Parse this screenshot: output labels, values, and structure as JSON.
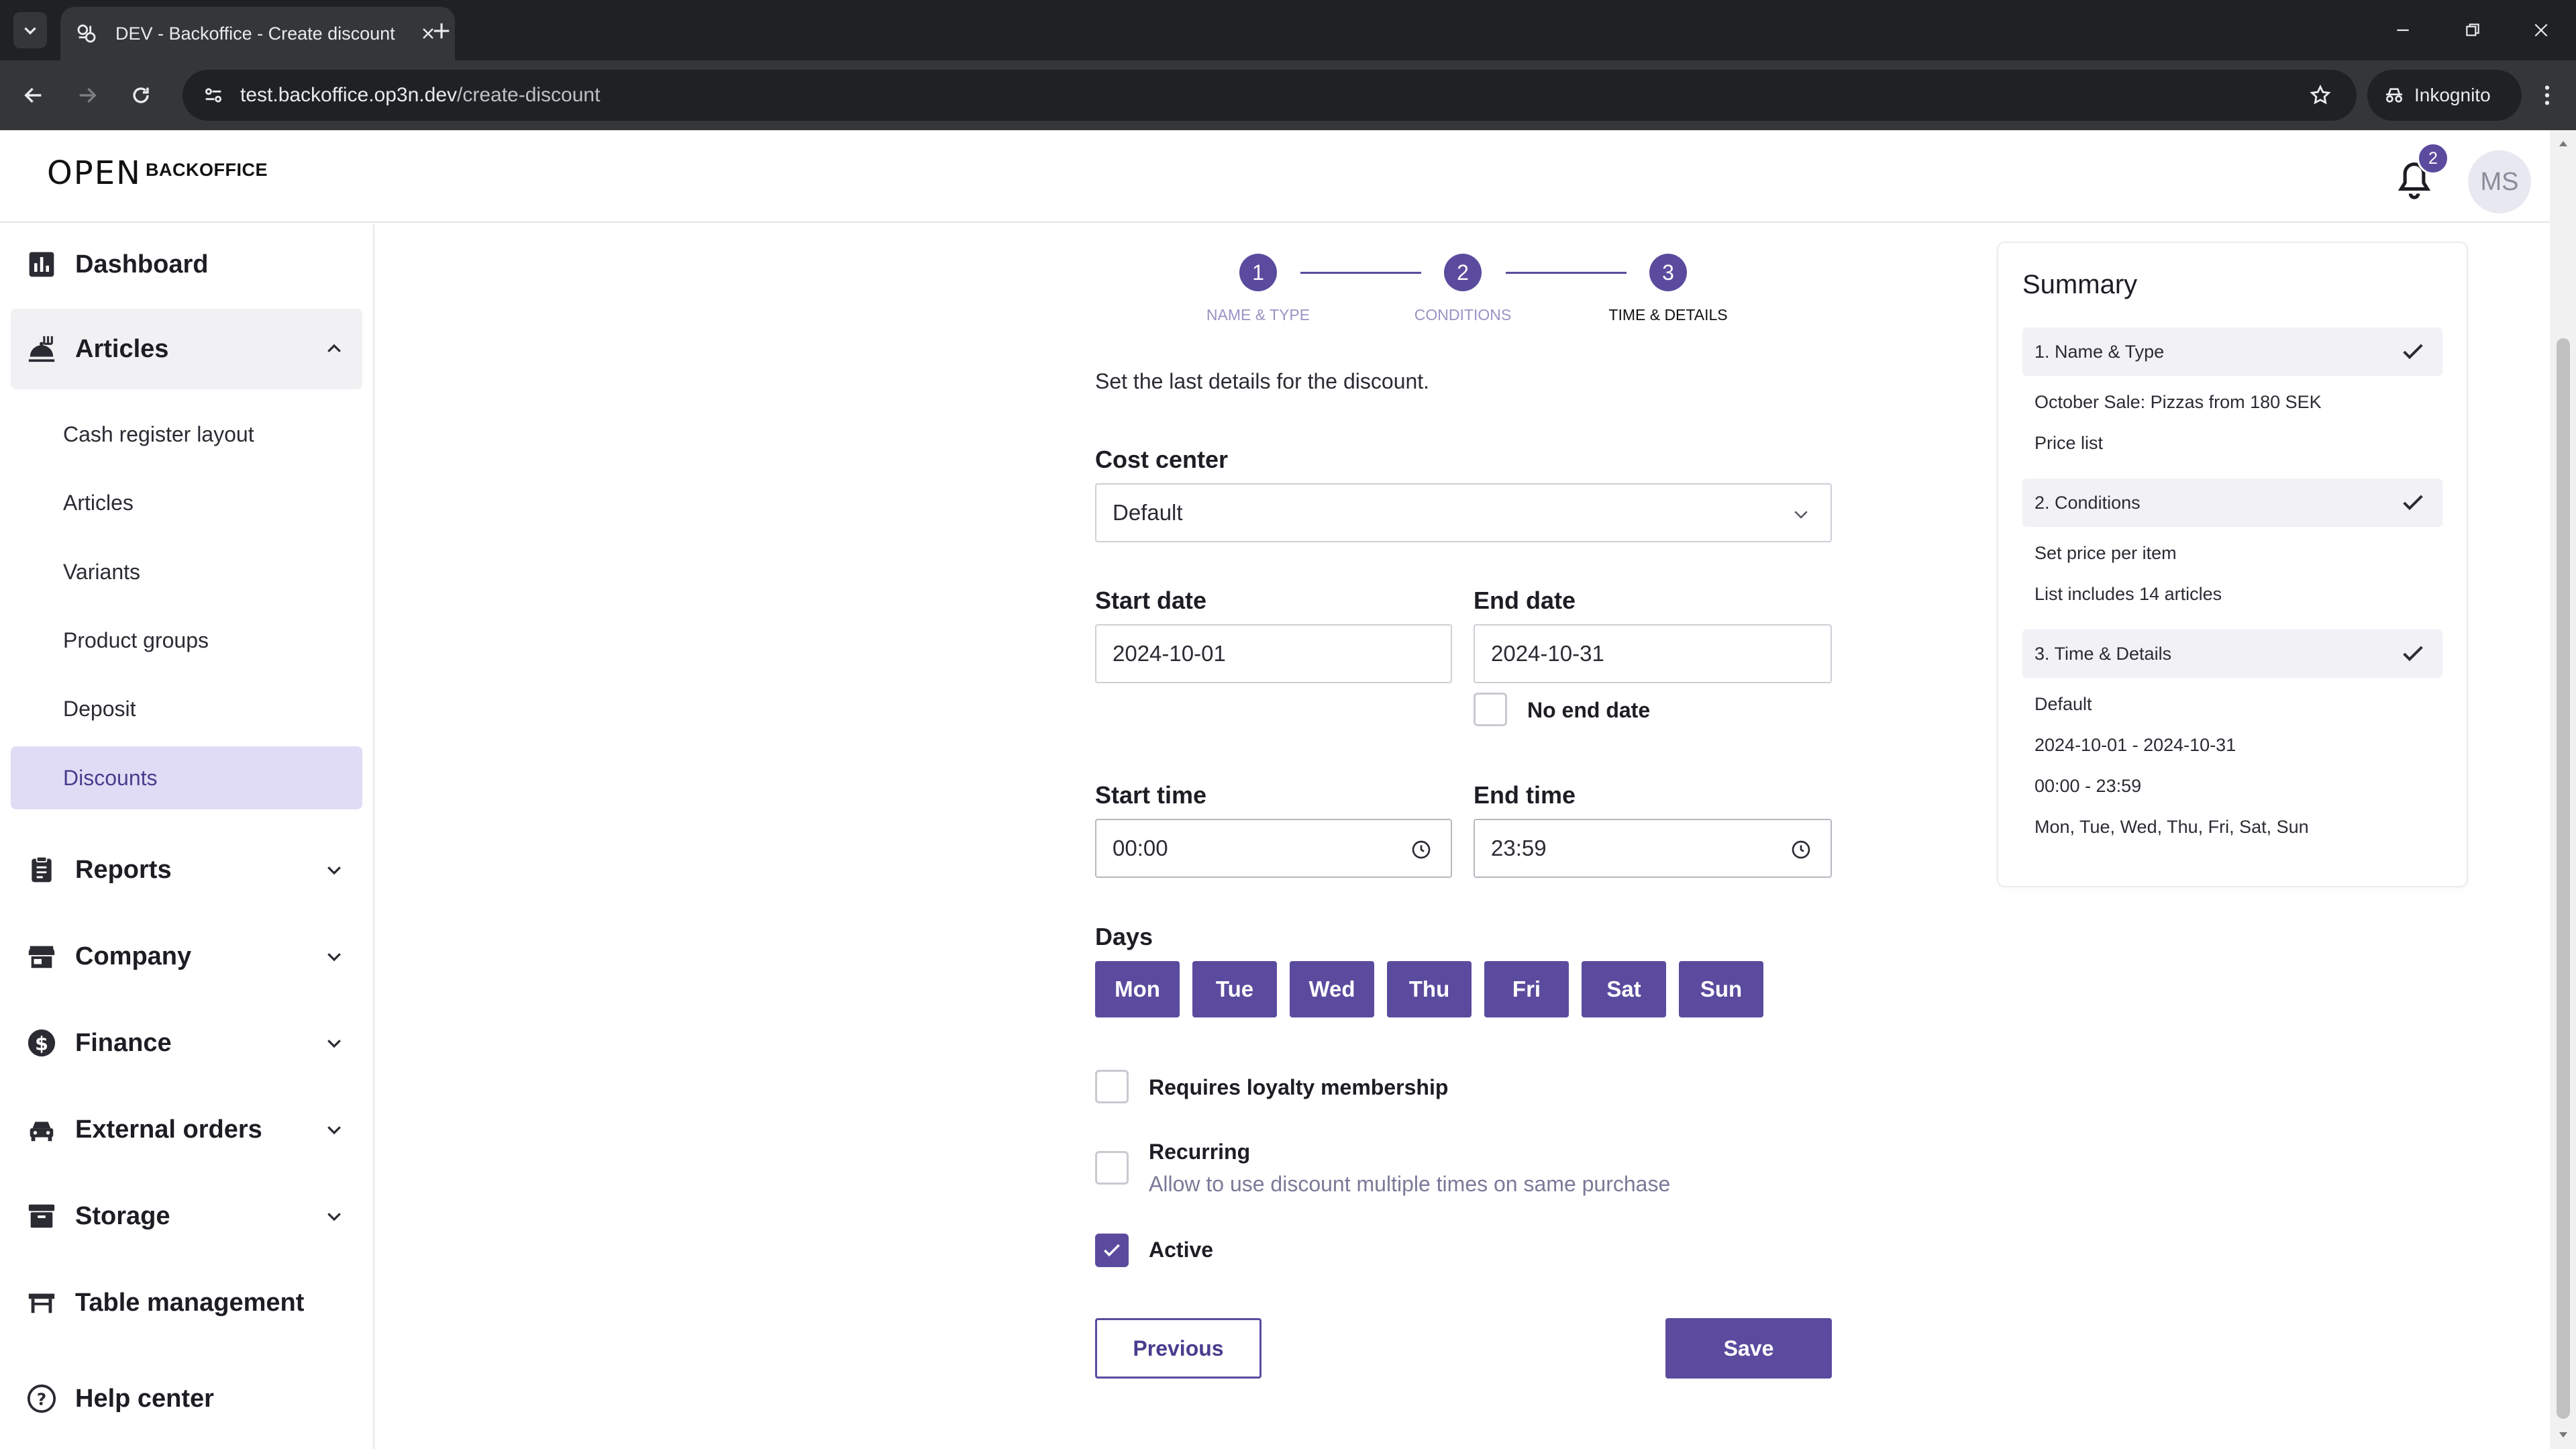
{
  "browser": {
    "tab_title": "DEV - Backoffice - Create discount",
    "url_host": "test.backoffice.op3n.dev",
    "url_path": "/create-discount",
    "incognito_label": "Inkognito"
  },
  "header": {
    "logo_text": "OPEN",
    "logo_suffix": "BACKOFFICE",
    "notification_count": "2",
    "avatar_initials": "MS"
  },
  "sidebar": {
    "dashboard": "Dashboard",
    "articles": "Articles",
    "articles_sub": [
      "Cash register layout",
      "Articles",
      "Variants",
      "Product groups",
      "Deposit",
      "Discounts"
    ],
    "reports": "Reports",
    "company": "Company",
    "finance": "Finance",
    "external_orders": "External orders",
    "storage": "Storage",
    "table_management": "Table management",
    "help_center": "Help center"
  },
  "stepper": {
    "steps": [
      {
        "number": "1",
        "label": "NAME & TYPE"
      },
      {
        "number": "2",
        "label": "CONDITIONS"
      },
      {
        "number": "3",
        "label": "TIME & DETAILS"
      }
    ]
  },
  "form": {
    "intro": "Set the last details for the discount.",
    "cost_center_label": "Cost center",
    "cost_center_value": "Default",
    "start_date_label": "Start date",
    "start_date_value": "2024-10-01",
    "end_date_label": "End date",
    "end_date_value": "2024-10-31",
    "no_end_date_label": "No end date",
    "start_time_label": "Start time",
    "start_time_value": "00:00",
    "end_time_label": "End time",
    "end_time_value": "23:59",
    "days_label": "Days",
    "days": [
      "Mon",
      "Tue",
      "Wed",
      "Thu",
      "Fri",
      "Sat",
      "Sun"
    ],
    "loyalty_label": "Requires loyalty membership",
    "recurring_label": "Recurring",
    "recurring_help": "Allow to use discount multiple times on same purchase",
    "active_label": "Active",
    "previous_label": "Previous",
    "save_label": "Save"
  },
  "summary": {
    "title": "Summary",
    "sections": [
      {
        "heading": "1. Name & Type",
        "lines": [
          "October Sale: Pizzas from 180 SEK",
          "Price list"
        ]
      },
      {
        "heading": "2. Conditions",
        "lines": [
          "Set price per item",
          "List includes 14 articles"
        ]
      },
      {
        "heading": "3. Time & Details",
        "lines": [
          "Default",
          "2024-10-01 - 2024-10-31",
          "00:00 - 23:59",
          "Mon, Tue, Wed, Thu, Fri, Sat, Sun"
        ]
      }
    ]
  },
  "colors": {
    "accent": "#5b4b9e",
    "accent_light": "#e1dcf5",
    "browser_dark": "#202124",
    "browser_toolbar": "#35363a"
  }
}
